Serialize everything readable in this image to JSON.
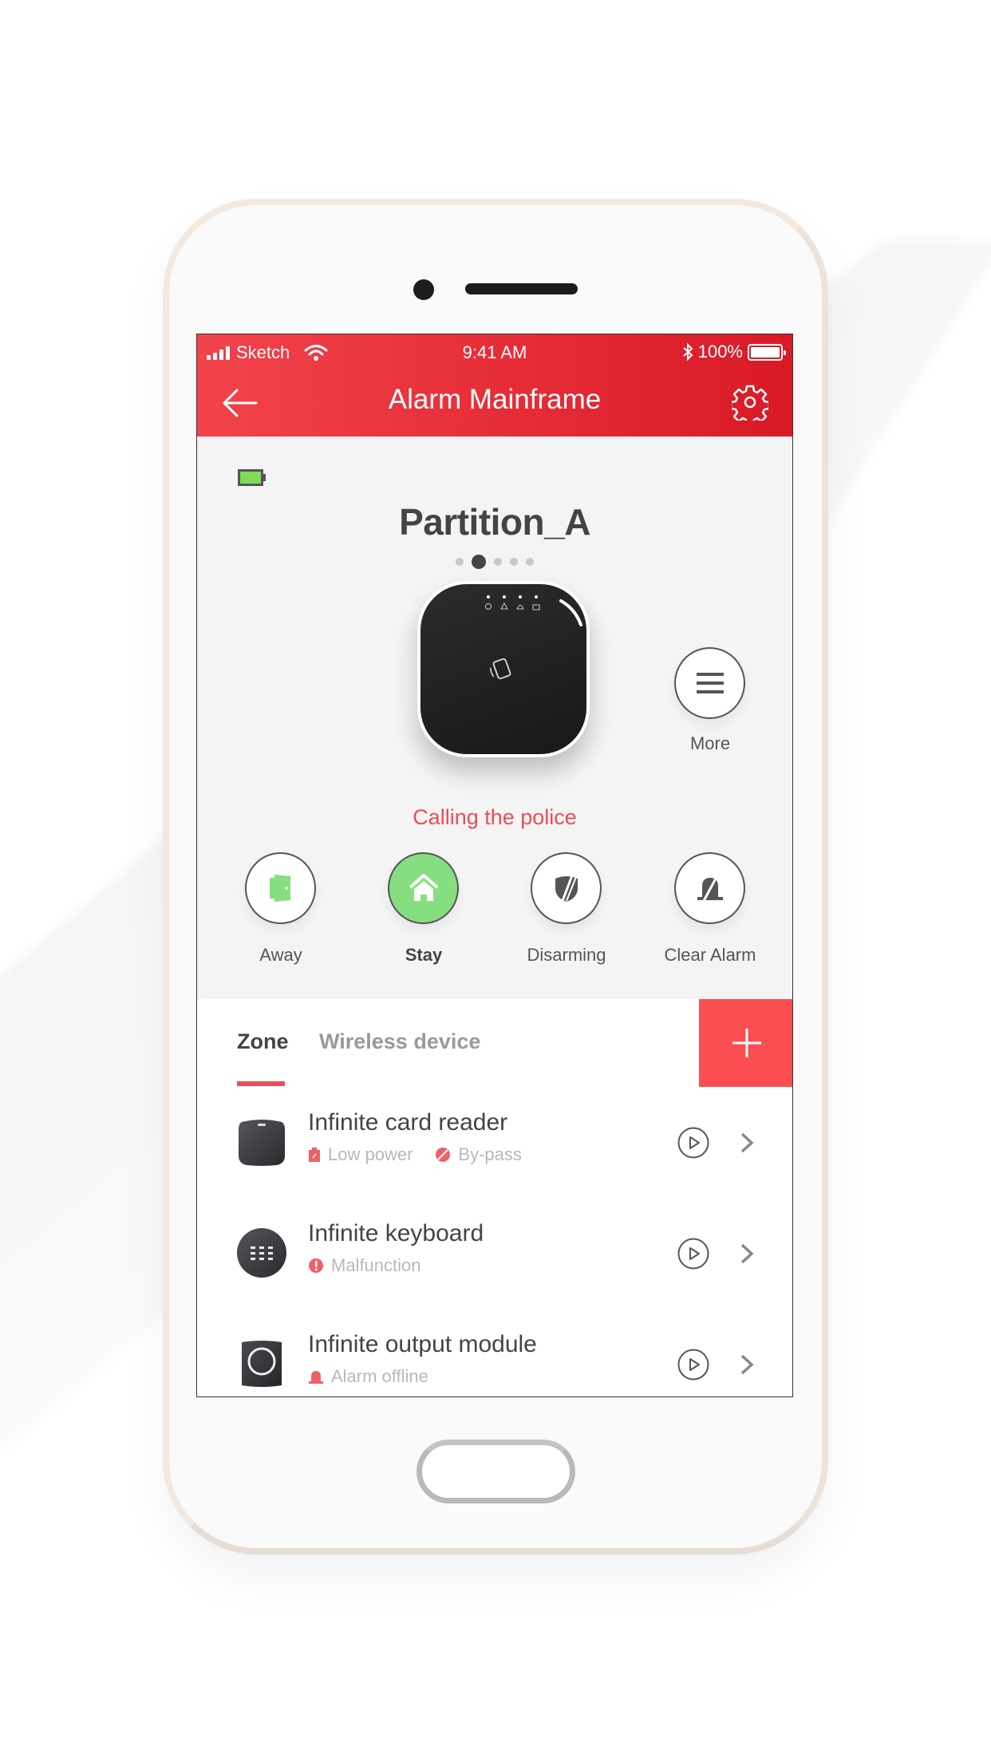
{
  "status_bar": {
    "carrier": "Sketch",
    "time": "9:41 AM",
    "battery_percent": "100%",
    "icons": [
      "signal-icon",
      "wifi-icon",
      "bluetooth-icon",
      "battery-icon"
    ]
  },
  "nav": {
    "title": "Alarm Mainframe",
    "back_icon": "arrow-left-icon",
    "settings_icon": "gear-icon"
  },
  "panel": {
    "battery_status_icon": "battery-full-green-icon",
    "partition_name": "Partition_A",
    "page_dots": {
      "count": 5,
      "active_index": 1
    },
    "device_image": "alarm-hub-device",
    "more_label": "More",
    "status_message": "Calling the police"
  },
  "actions": [
    {
      "id": "away",
      "label": "Away",
      "icon": "door-icon",
      "active": false
    },
    {
      "id": "stay",
      "label": "Stay",
      "icon": "home-icon",
      "active": true
    },
    {
      "id": "disarming",
      "label": "Disarming",
      "icon": "shield-off-icon",
      "active": false
    },
    {
      "id": "clear_alarm",
      "label": "Clear Alarm",
      "icon": "bell-off-icon",
      "active": false
    }
  ],
  "tabs": {
    "items": [
      {
        "label": "Zone",
        "active": true
      },
      {
        "label": "Wireless device",
        "active": false
      }
    ],
    "add_icon": "plus-icon"
  },
  "devices": [
    {
      "name": "Infinite card reader",
      "icon": "card-reader-icon",
      "statuses": [
        {
          "label": "Low power",
          "icon": "low-battery-icon"
        },
        {
          "label": "By-pass",
          "icon": "bypass-icon"
        }
      ]
    },
    {
      "name": "Infinite keyboard",
      "icon": "keyboard-icon",
      "statuses": [
        {
          "label": "Malfunction",
          "icon": "alert-icon"
        }
      ]
    },
    {
      "name": "Infinite output module",
      "icon": "output-module-icon",
      "statuses": [
        {
          "label": "Alarm offline",
          "icon": "siren-icon"
        }
      ]
    }
  ],
  "colors": {
    "header_start": "#f2434b",
    "header_end": "#d81a26",
    "accent_red": "#fb4f52",
    "alert_text": "#ea4e56",
    "active_green": "#85df80",
    "text_dark": "#444444",
    "text_muted": "#b8b8b8"
  }
}
